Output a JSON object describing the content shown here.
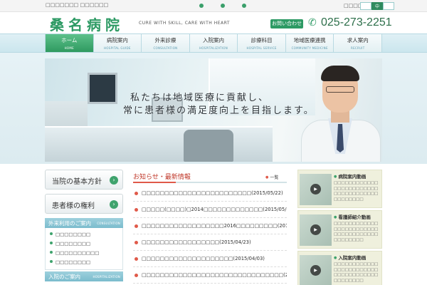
{
  "topbar": {
    "breadcrumb": "□□□□□□□ □□□□□□",
    "font_size_label": "□□□□□□□",
    "font_size_buttons": [
      {
        "label": "",
        "active": false
      },
      {
        "label": "中",
        "active": true
      },
      {
        "label": "",
        "active": false
      }
    ]
  },
  "header": {
    "logo": "桑名病院",
    "tagline": "CURE WITH SKILL, CARE WITH HEART",
    "contact_label": "お問い合わせ",
    "phone": "025-273-2251"
  },
  "nav": {
    "items": [
      {
        "label": "ホーム",
        "sub": "HOME",
        "active": true
      },
      {
        "label": "病院案内",
        "sub": "HOSPITAL GUIDE",
        "active": false
      },
      {
        "label": "外来診療",
        "sub": "CONSULTATION",
        "active": false
      },
      {
        "label": "入院案内",
        "sub": "HOSPITALIZATION",
        "active": false
      },
      {
        "label": "診療科目",
        "sub": "HOSPITAL SERVICE",
        "active": false
      },
      {
        "label": "地域医療連携",
        "sub": "COMMUNITY MEDICINE",
        "active": false
      },
      {
        "label": "求人案内",
        "sub": "RECRUIT",
        "active": false
      }
    ]
  },
  "hero": {
    "line1": "私たちは地域医療に貢献し、",
    "line2": "常に患者様の満足度向上を目指します。"
  },
  "sidebar": {
    "pills": [
      {
        "label": "当院の基本方針"
      },
      {
        "label": "患者様の権利"
      }
    ],
    "sections": [
      {
        "title": "外来利用のご案内",
        "sub": "CONSULTATION",
        "items": [
          "□□□□□□□□",
          "□□□□□□□□",
          "□□□□□□□□□□",
          "□□□□□□□□"
        ]
      },
      {
        "title": "入院のご案内",
        "sub": "HOSPITALIZATION",
        "items": []
      }
    ]
  },
  "news": {
    "title": "お知らせ・最新情報",
    "list_link": "一覧",
    "items": [
      "□□□□□□□□□□□□□□□□□□□□□□□□(2015/05/22)",
      "□□□□□(□□□□)□2014□□□□□□□□□□□□□(2015/05/08)",
      "□□□□□□□□□□□□□□□□□□2016□□□□□□□□□(2015/04/27)",
      "□□□□□□□□□□□□□□□□□(2015/04/23)",
      "□□□□□□□□□□□□□□□□□□□□(2015/04/03)",
      "□□□□□□□□□□□□□□□□□□□□□□□□□□□□□□□(2015/04/03)"
    ]
  },
  "videos": [
    {
      "title": "病院案内動画",
      "desc": "□□□□□□□□□□□□□□□□□□□□□□□□□□□□□□□□□□□□□□□□□□□□"
    },
    {
      "title": "看護師紹介動画",
      "desc": "□□□□□□□□□□□□□□□□□□□□□□□□□□□□□□□□□□□□□□□□□□□□"
    },
    {
      "title": "入院案内動画",
      "desc": "□□□□□□□□□□□□□□□□□□□□□□□□□□□□□□□□□□□□□□□□□□□□"
    }
  ],
  "icons": {
    "phone": "phone-icon",
    "play": "play-icon",
    "arrow": "arrow-right-icon"
  },
  "colors": {
    "brand_green": "#2d9a64",
    "news_red": "#c0392b",
    "nav_blue": "#cbe6ee"
  }
}
